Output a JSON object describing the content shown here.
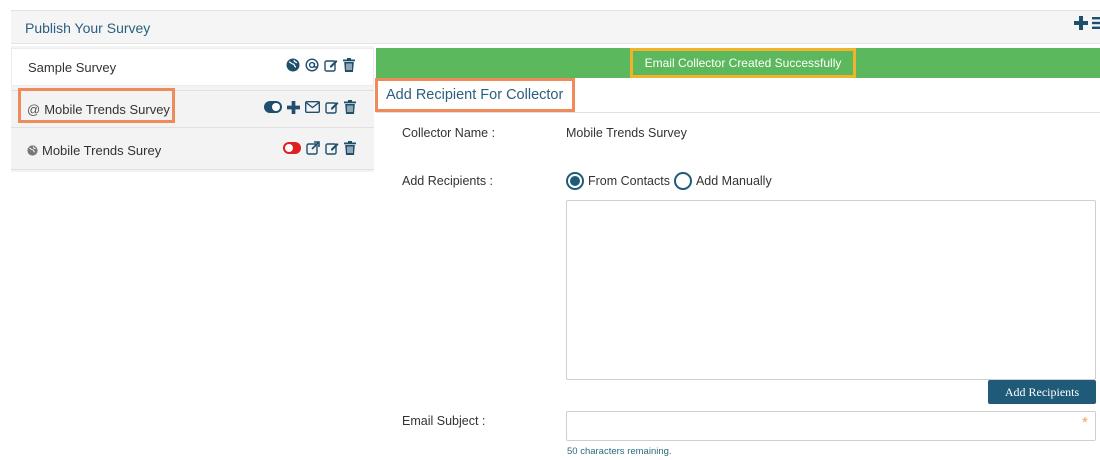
{
  "header": {
    "title": "Publish Your Survey",
    "actions": [
      {
        "icon": "plus-icon"
      },
      {
        "icon": "menu-icon"
      }
    ]
  },
  "surveys": [
    {
      "label": "Sample Survey",
      "prefix_icon": "",
      "icons": [
        "globe-icon",
        "at-icon",
        "edit-icon",
        "trash-icon"
      ]
    },
    {
      "label": "Mobile Trends Survey",
      "prefix_icon": "@",
      "icons": [
        "toggle-on-icon",
        "plus-icon",
        "mail-icon",
        "edit-icon",
        "trash-icon"
      ]
    },
    {
      "label": "Mobile Trends Surey",
      "prefix_icon": "globe",
      "icons": [
        "toggle-off-icon",
        "external-link-icon",
        "edit-icon",
        "trash-icon"
      ]
    }
  ],
  "banner": {
    "message": "Email Collector Created Successfully",
    "color": "#5cb85c"
  },
  "section": {
    "title": "Add Recipient For Collector"
  },
  "form": {
    "collector_name_label": "Collector Name :",
    "collector_name_value": "Mobile Trends Survey",
    "add_recipients_label": "Add Recipients :",
    "radio_from_contacts": "From Contacts",
    "radio_add_manually": "Add Manually",
    "recipients_text": "",
    "add_recipients_button": "Add Recipients",
    "email_subject_label": "Email Subject :",
    "email_subject_value": "",
    "chars_remaining": "50 characters remaining."
  },
  "colors": {
    "accent": "#1f5a78",
    "highlight_orange": "#ef8a5a",
    "highlight_yellow": "#f2b32a",
    "toggle_off": "#e02020"
  }
}
